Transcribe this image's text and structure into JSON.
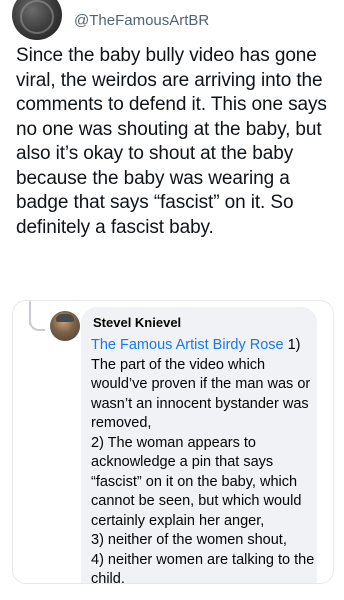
{
  "header": {
    "author_name": "",
    "handle": "@TheFamousArtBR",
    "avatar_icon": "profile-avatar-icon"
  },
  "tweet": {
    "text": "Since the baby bully video has gone viral, the weirdos are arriving into the comments to defend it. This one says no one was shouting at the baby, but also it’s okay to shout at the baby because the baby was wearing a badge that says “fascist” on it. So definitely a fascist baby."
  },
  "embedded_comment": {
    "commenter_name": "Stevel Knievel",
    "mention": "The Famous Artist Birdy Rose",
    "body": " 1)\nThe part of the video which would’ve proven if the man was or wasn’t an innocent bystander was removed,\n2) The woman appears to acknowledge a pin that says “fascist” on it on the baby, which cannot be seen, but which would certainly explain her anger,\n3) neither of the women shout,\n4) neither women are talking to the child.",
    "colors": {
      "bubble_bg": "#f0f2f5",
      "mention": "#1877f2"
    }
  }
}
